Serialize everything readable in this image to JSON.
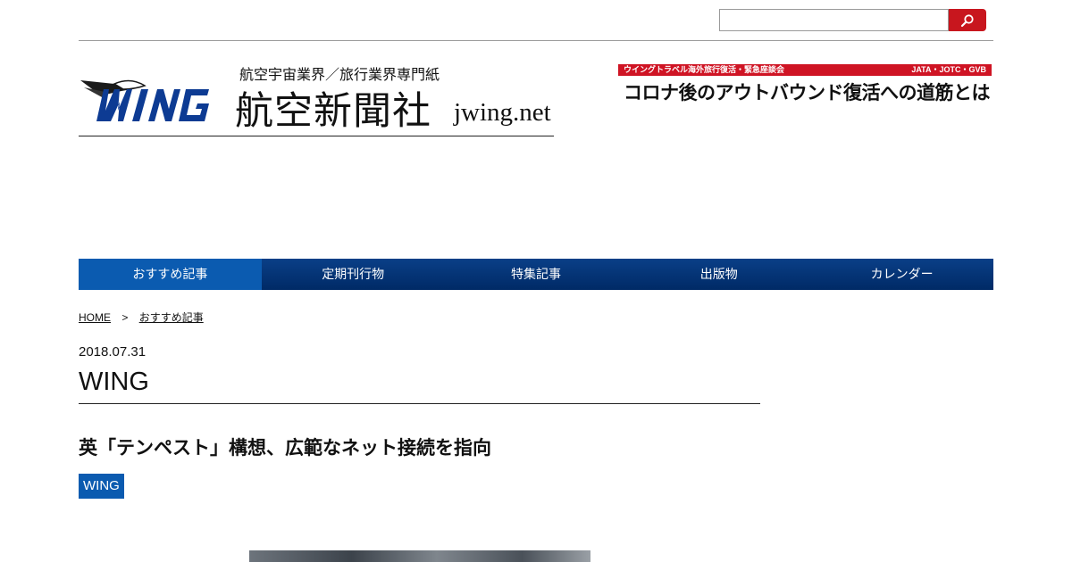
{
  "search": {
    "placeholder": "",
    "value": ""
  },
  "header": {
    "logo_text": "WING",
    "tagline": "航空宇宙業界／旅行業界専門紙",
    "company_name": "航空新聞社",
    "domain": "jwing.net"
  },
  "banner": {
    "top_left": "ウイングトラベル海外旅行復活・緊急座談会",
    "top_right": "JATA・JOTC・GVB",
    "headline": "コロナ後のアウトバウンド復活への道筋とは"
  },
  "nav": {
    "items": [
      {
        "label": "おすすめ記事",
        "active": true
      },
      {
        "label": "定期刊行物",
        "active": false
      },
      {
        "label": "特集記事",
        "active": false
      },
      {
        "label": "出版物",
        "active": false
      },
      {
        "label": "カレンダー",
        "active": false
      }
    ]
  },
  "breadcrumb": {
    "home": "HOME",
    "separator": ">",
    "current": "おすすめ記事"
  },
  "post": {
    "date": "2018.07.31",
    "category": "WING",
    "title": "英「テンペスト」構想、広範なネット接続を指向",
    "tag": "WING"
  },
  "colors": {
    "nav_bg": "#002a66",
    "nav_active": "#0b5bb0",
    "search_button": "#c8161e",
    "banner_red": "#cf1424",
    "logo_blue": "#0d3b93"
  },
  "icons": {
    "search": "magnifier-icon"
  }
}
